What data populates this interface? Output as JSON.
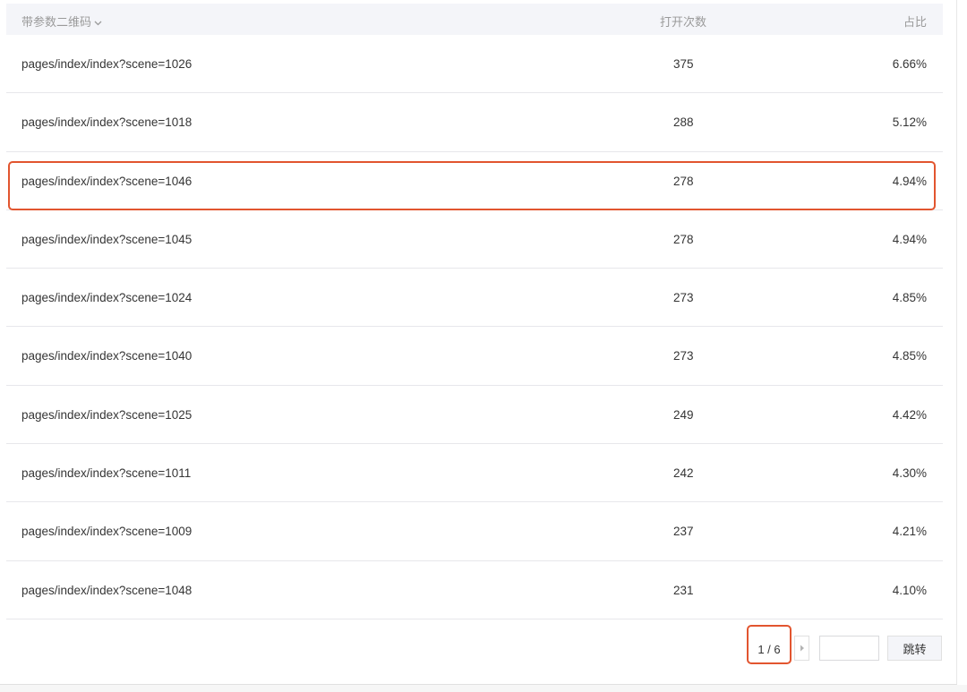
{
  "table": {
    "headers": {
      "qr_code": "带参数二维码",
      "open_count": "打开次数",
      "ratio": "占比"
    },
    "rows": [
      {
        "path": "pages/index/index?scene=1026",
        "open_count": "375",
        "ratio": "6.66%"
      },
      {
        "path": "pages/index/index?scene=1018",
        "open_count": "288",
        "ratio": "5.12%"
      },
      {
        "path": "pages/index/index?scene=1046",
        "open_count": "278",
        "ratio": "4.94%"
      },
      {
        "path": "pages/index/index?scene=1045",
        "open_count": "278",
        "ratio": "4.94%"
      },
      {
        "path": "pages/index/index?scene=1024",
        "open_count": "273",
        "ratio": "4.85%"
      },
      {
        "path": "pages/index/index?scene=1040",
        "open_count": "273",
        "ratio": "4.85%"
      },
      {
        "path": "pages/index/index?scene=1025",
        "open_count": "249",
        "ratio": "4.42%"
      },
      {
        "path": "pages/index/index?scene=1011",
        "open_count": "242",
        "ratio": "4.30%"
      },
      {
        "path": "pages/index/index?scene=1009",
        "open_count": "237",
        "ratio": "4.21%"
      },
      {
        "path": "pages/index/index?scene=1048",
        "open_count": "231",
        "ratio": "4.10%"
      }
    ]
  },
  "pagination": {
    "page_indicator": "1 / 6",
    "jump_input_value": "",
    "jump_label": "跳转"
  },
  "icons": {
    "header_sort": "chevron-down-icon",
    "next_page": "caret-right-icon"
  },
  "colors": {
    "highlight_border": "#e2552f",
    "header_bg": "#f4f5f9",
    "header_text": "#9a9a9a"
  }
}
